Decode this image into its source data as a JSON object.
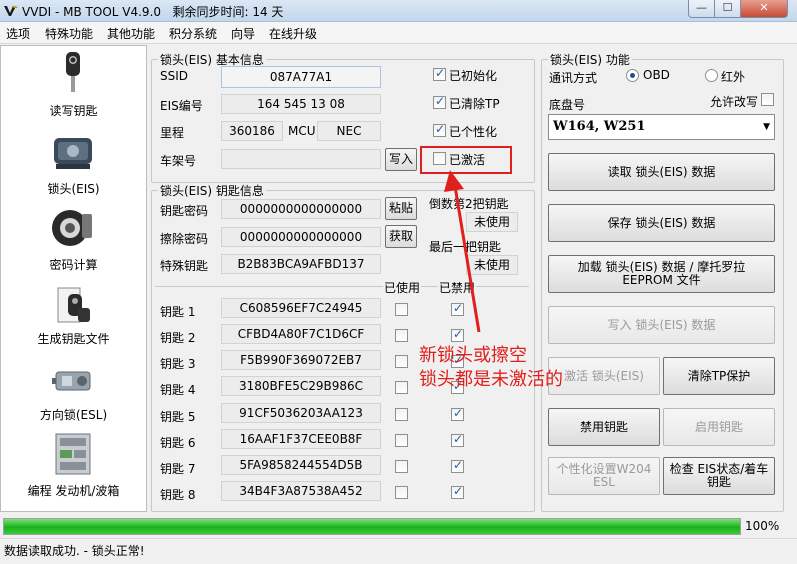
{
  "window": {
    "title": "VVDI - MB TOOL V4.9.0",
    "sync_time": "剩余同步时间: 14 天",
    "min_label": "—",
    "max_label": "☐",
    "close_label": "✕"
  },
  "menu": [
    "选项",
    "特殊功能",
    "其他功能",
    "积分系统",
    "向导",
    "在线升级"
  ],
  "nav": [
    {
      "label": "读写钥匙",
      "icon": "car-key-icon"
    },
    {
      "label": "锁头(EIS)",
      "icon": "eis-module-icon"
    },
    {
      "label": "密码计算",
      "icon": "password-calculator-icon"
    },
    {
      "label": "生成钥匙文件",
      "icon": "key-file-icon"
    },
    {
      "label": "方向锁(ESL)",
      "icon": "steering-lock-icon"
    },
    {
      "label": "编程 发动机/波箱",
      "icon": "ecu-board-icon"
    }
  ],
  "eis_info": {
    "legend": "锁头(EIS) 基本信息",
    "ssid_label": "SSID",
    "ssid_value": "087A77A1",
    "eis_no_label": "EIS编号",
    "eis_no_value": "164 545 13 08",
    "mileage_label": "里程",
    "mileage_value": "360186",
    "mcu_label": "MCU",
    "mcu_value": "NEC",
    "vin_label": "车架号",
    "vin_value": "",
    "write_btn": "写入",
    "initialized": "已初始化",
    "tp_cleared": "已清除TP",
    "personalized": "已个性化",
    "activated": "已激活"
  },
  "key_info": {
    "legend": "锁头(EIS) 钥匙信息",
    "key_password_label": "钥匙密码",
    "key_password_value": "0000000000000000",
    "erase_password_label": "擦除密码",
    "erase_password_value": "0000000000000000",
    "special_key_label": "特殊钥匙",
    "special_key_value": "B2B83BCA9AFBD137",
    "paste_btn": "粘贴",
    "get_btn": "获取",
    "second_last_label": "倒数第2把钥匙",
    "second_last_value": "未使用",
    "last_label": "最后一把钥匙",
    "last_value": "未使用",
    "used_header": "已使用",
    "disabled_header": "已禁用",
    "keys": [
      {
        "label": "钥匙 1",
        "value": "C608596EF7C24945",
        "used": false,
        "disabled": true
      },
      {
        "label": "钥匙 2",
        "value": "CFBD4A80F7C1D6CF",
        "used": false,
        "disabled": true
      },
      {
        "label": "钥匙 3",
        "value": "F5B990F369072EB7",
        "used": false,
        "disabled": true
      },
      {
        "label": "钥匙 4",
        "value": "3180BFE5C29B986C",
        "used": false,
        "disabled": true
      },
      {
        "label": "钥匙 5",
        "value": "91CF5036203AA123",
        "used": false,
        "disabled": true
      },
      {
        "label": "钥匙 6",
        "value": "16AAF1F37CEE0B8F",
        "used": false,
        "disabled": true
      },
      {
        "label": "钥匙 7",
        "value": "5FA9858244554D5B",
        "used": false,
        "disabled": true
      },
      {
        "label": "钥匙 8",
        "value": "34B4F3A87538A452",
        "used": false,
        "disabled": true
      }
    ]
  },
  "eis_func": {
    "legend": "锁头(EIS) 功能",
    "comm_label": "通讯方式",
    "obd_label": "OBD",
    "ir_label": "红外",
    "chassis_label": "底盘号",
    "allow_modify_label": "允许改写",
    "chassis_value": "W164, W251",
    "read_btn": "读取 锁头(EIS) 数据",
    "save_btn": "保存 锁头(EIS) 数据",
    "load_btn": "加载 锁头(EIS) 数据 / 摩托罗拉EEPROM 文件",
    "write_btn": "写入 锁头(EIS) 数据",
    "activate_btn": "激活 锁头(EIS)",
    "clear_tp_btn": "清除TP保护",
    "disable_key_btn": "禁用钥匙",
    "enable_key_btn": "启用钥匙",
    "personalize_btn": "个性化设置W204 ESL",
    "check_eis_btn": "检查 EIS状态/着车钥匙"
  },
  "annotation": {
    "line1": "新锁头或擦空",
    "line2": "锁头都是未激活的"
  },
  "progress": {
    "percent": 100,
    "label": "100%"
  },
  "status": "数据读取成功. - 锁头正常!"
}
